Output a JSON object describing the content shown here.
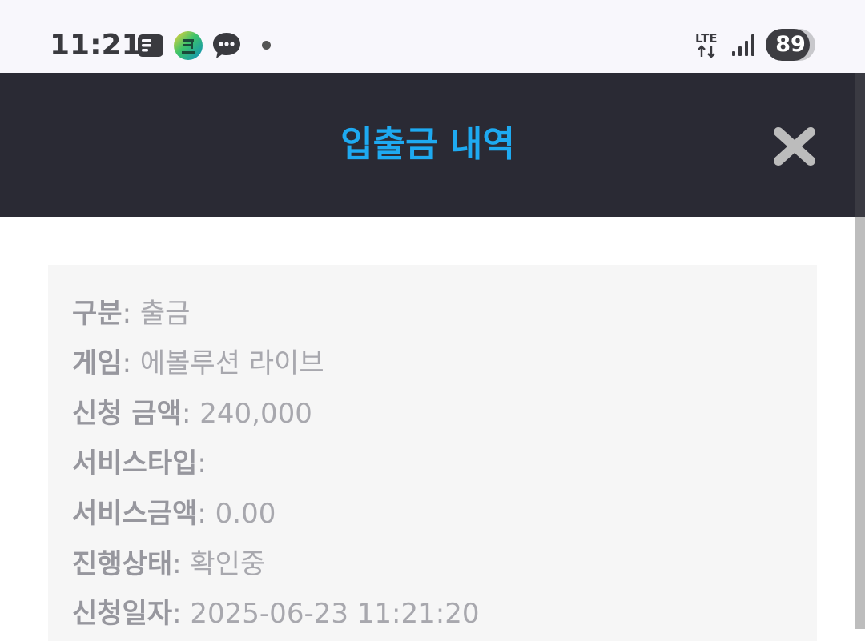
{
  "status_bar": {
    "time": "11:21",
    "network": "LTE",
    "battery": "89",
    "battery_level": 0.89,
    "icons": [
      "notes-icon",
      "green-app-icon",
      "chat-bubble-icon",
      "dot-icon",
      "lte-icon",
      "signal-icon",
      "battery-icon"
    ]
  },
  "header": {
    "title": "입출금 내역",
    "close_icon": "close-icon"
  },
  "colors": {
    "header_bg": "#2a2a34",
    "title": "#1eaaf1",
    "card_bg": "#f6f6f6",
    "text": "#9c9ca3"
  },
  "details": {
    "rows": [
      {
        "label": "구분",
        "value": "출금"
      },
      {
        "label": "게임",
        "value": "에볼루션 라이브"
      },
      {
        "label": "신청 금액",
        "value": "240,000"
      },
      {
        "label": "서비스타입",
        "value": ""
      },
      {
        "label": "서비스금액",
        "value": "0.00"
      },
      {
        "label": "진행상태",
        "value": "확인중"
      },
      {
        "label": "신청일자",
        "value": "2025-06-23 11:21:20"
      }
    ]
  }
}
